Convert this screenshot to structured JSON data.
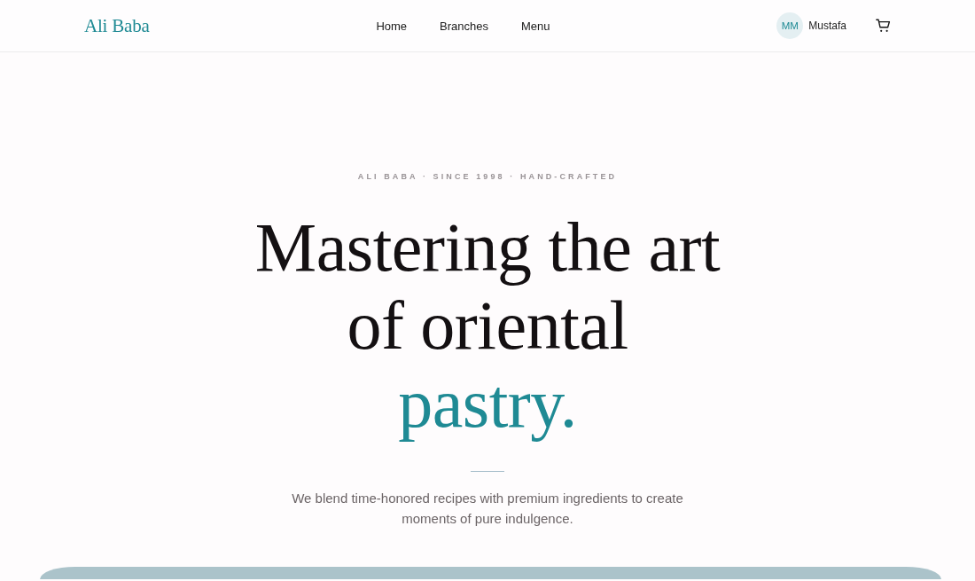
{
  "header": {
    "logo": "Ali Baba",
    "nav": [
      {
        "label": "Home"
      },
      {
        "label": "Branches"
      },
      {
        "label": "Menu"
      }
    ],
    "user": {
      "initials": "MM",
      "name": "Mustafa"
    }
  },
  "hero": {
    "eyebrow": "ALI BABA · SINCE 1998 · HAND-CRAFTED",
    "headline": "Mastering the art of oriental",
    "headline_accent": "pastry.",
    "intro": "We blend time-honored recipes with premium ingredients to create moments of pure indulgence."
  }
}
